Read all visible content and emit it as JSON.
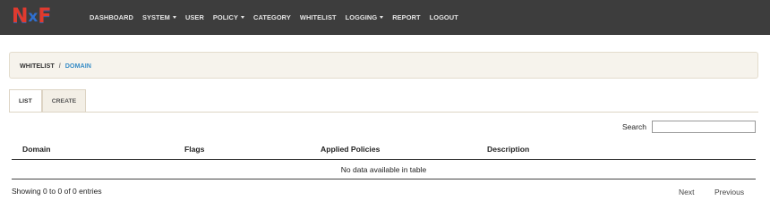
{
  "brand": {
    "logo_text_1": "N",
    "logo_text_2": "x",
    "logo_text_3": "F"
  },
  "nav": {
    "items": [
      {
        "label": "DASHBOARD",
        "dropdown": false
      },
      {
        "label": "SYSTEM",
        "dropdown": true
      },
      {
        "label": "USER",
        "dropdown": false
      },
      {
        "label": "POLICY",
        "dropdown": true
      },
      {
        "label": "CATEGORY",
        "dropdown": false
      },
      {
        "label": "WHITELIST",
        "dropdown": false
      },
      {
        "label": "LOGGING",
        "dropdown": true
      },
      {
        "label": "REPORT",
        "dropdown": false
      },
      {
        "label": "LOGOUT",
        "dropdown": false
      }
    ]
  },
  "breadcrumb": {
    "parent": "WHITELIST",
    "separator": "/",
    "current": "DOMAIN"
  },
  "tabs": [
    {
      "label": "LIST",
      "active": true
    },
    {
      "label": "CREATE",
      "active": false
    }
  ],
  "search": {
    "label": "Search",
    "value": ""
  },
  "table": {
    "columns": [
      "Domain",
      "Flags",
      "Applied Policies",
      "Description"
    ],
    "rows": [],
    "empty_message": "No data available in table"
  },
  "footer": {
    "info": "Showing 0 to 0 of 0 entries",
    "next_label": "Next",
    "previous_label": "Previous"
  },
  "colors": {
    "navbar": "#3d3d3d",
    "accent": "#3a8ec7",
    "logo_red": "#e03a2e",
    "logo_blue": "#2f6fd0",
    "breadcrumb_bg": "#f6f3ec"
  }
}
